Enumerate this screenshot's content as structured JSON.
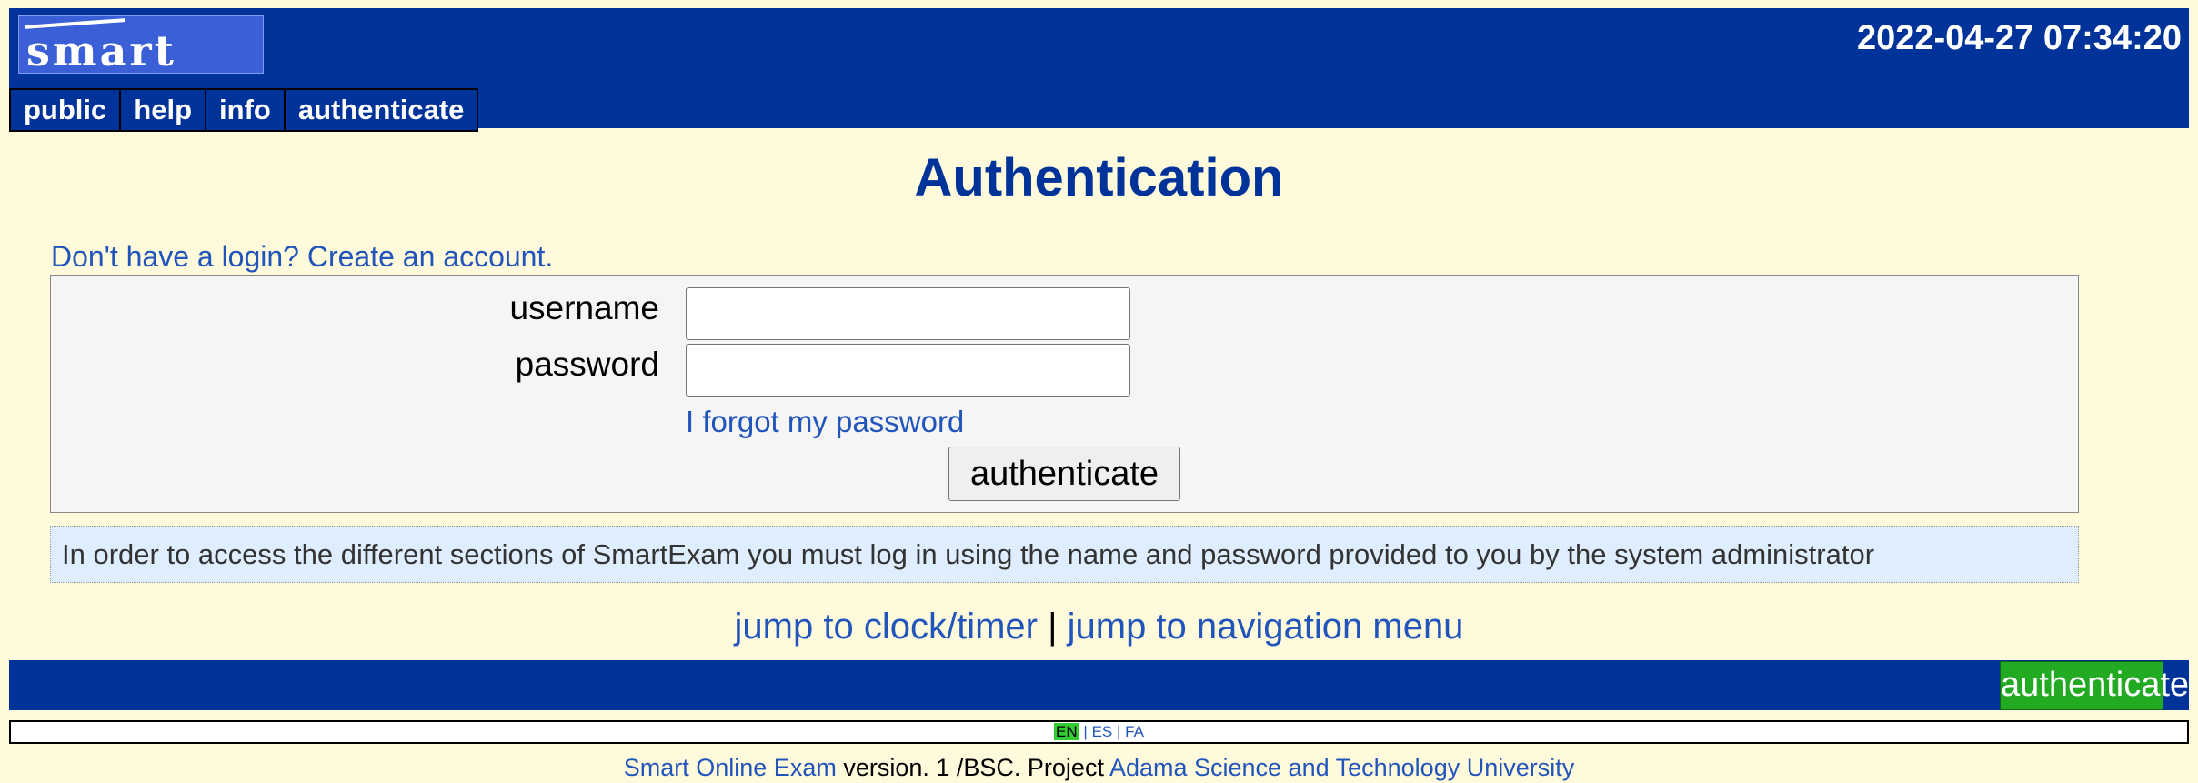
{
  "header": {
    "logo_text": "smart",
    "datetime": "2022-04-27 07:34:20",
    "nav": [
      {
        "label": "public"
      },
      {
        "label": "help"
      },
      {
        "label": "info"
      },
      {
        "label": "authenticate"
      }
    ]
  },
  "main": {
    "title": "Authentication",
    "create_account_link": "Don't have a login? Create an account.",
    "form": {
      "username_label": "username",
      "username_value": "",
      "password_label": "password",
      "password_value": "",
      "forgot_link": "I forgot my password",
      "submit_label": "authenticate"
    },
    "info_text": "In order to access the different sections of SmartExam you must log in using the name and password provided to you by the system administrator",
    "jump": {
      "clock_link": "jump to clock/timer",
      "separator": "|",
      "nav_link": "jump to navigation menu"
    }
  },
  "footer": {
    "button_label": "authenticate",
    "languages": {
      "active": "EN",
      "sep1": "|",
      "es": "ES",
      "sep2": "|",
      "fa": "FA"
    },
    "credits": {
      "app_link": "Smart Online Exam",
      "middle_text": " version. 1 /BSC. Project ",
      "university_link": "Adama Science and Technology University"
    }
  },
  "colors": {
    "header_bg": "#00339a",
    "page_bg": "#fffadc",
    "link": "#2255bb",
    "title": "#00339a",
    "footer_button": "#22aa22",
    "info_bg": "#dfeeff",
    "form_bg": "#f5f5f5"
  }
}
